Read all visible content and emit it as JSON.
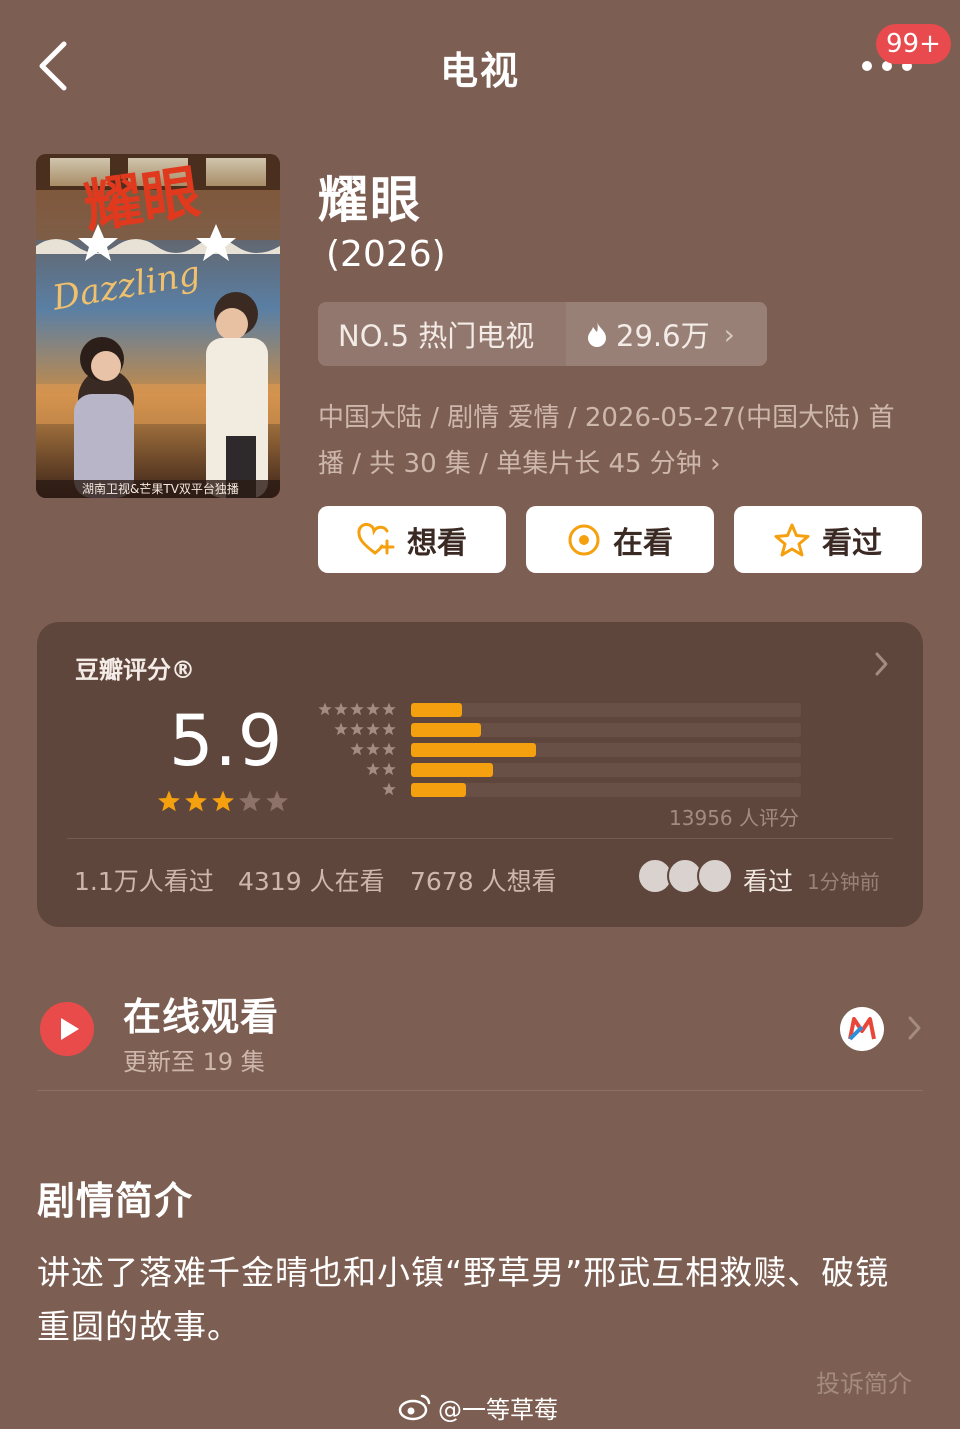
{
  "header": {
    "title": "电视",
    "notification_badge": "99+"
  },
  "drama": {
    "title": "耀眼",
    "year": "(2026)",
    "rank_label": "NO.5 热门电视",
    "heat_value": "29.6万",
    "meta_line1": "中国大陆 / 剧情 爱情 / 2026-05-27(中国大陆) 首",
    "meta_line2": "播 / 共 30 集 / 单集片长 45 分钟",
    "poster": {
      "title_art": "耀眼",
      "english_title": "Dazzling",
      "footer": "湖南卫视&芒果TV双平台独播"
    }
  },
  "actions": {
    "want": "想看",
    "watching": "在看",
    "watched": "看过"
  },
  "rating": {
    "source": "豆瓣评分®",
    "score": "5.9",
    "stars_filled": 3,
    "stars_total": 5,
    "count_text": "13956 人评分",
    "distribution": [
      {
        "stars": 5,
        "fraction": 0.13
      },
      {
        "stars": 4,
        "fraction": 0.18
      },
      {
        "stars": 3,
        "fraction": 0.32
      },
      {
        "stars": 2,
        "fraction": 0.21
      },
      {
        "stars": 1,
        "fraction": 0.14
      }
    ],
    "stats": {
      "watched": "1.1万人看过",
      "watching": "4319 人在看",
      "want": "7678 人想看"
    },
    "activity": {
      "action": "看过",
      "time": "1分钟前"
    },
    "accent_color": "#f5a00f"
  },
  "online": {
    "title": "在线观看",
    "subtitle": "更新至 19 集",
    "platform_icon": "mango-tv-logo",
    "play_color": "#e94b4b"
  },
  "synopsis": {
    "heading": "剧情简介",
    "text": "讲述了落难千金晴也和小镇“野草男”邢武互相救赎、破镜重圆的故事。",
    "report_label": "投诉简介"
  },
  "watermark": {
    "text": "@一等草莓"
  }
}
